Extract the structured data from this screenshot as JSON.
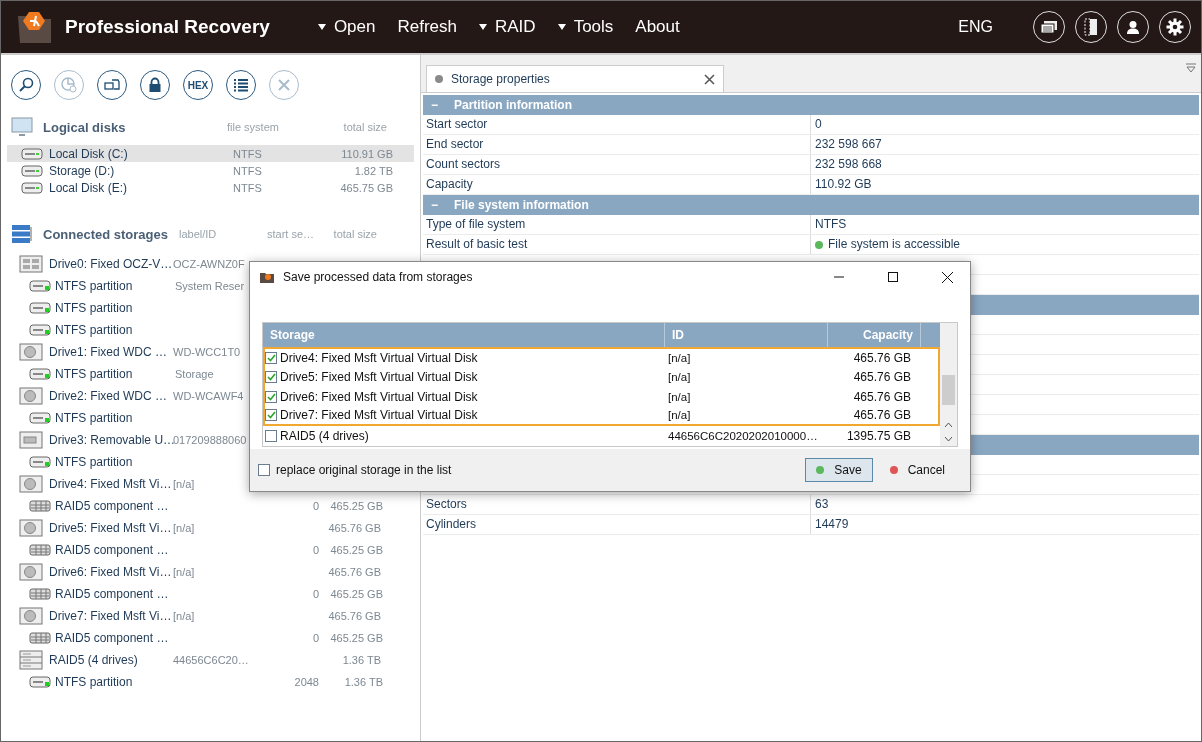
{
  "app": {
    "title": "Professional Recovery",
    "language": "ENG"
  },
  "menu": [
    {
      "label": "Open",
      "dropdown": true
    },
    {
      "label": "Refresh",
      "dropdown": false
    },
    {
      "label": "RAID",
      "dropdown": true
    },
    {
      "label": "Tools",
      "dropdown": true
    },
    {
      "label": "About",
      "dropdown": false
    }
  ],
  "top_icons": [
    {
      "kind": "windows"
    },
    {
      "kind": "panel"
    },
    {
      "kind": "user"
    },
    {
      "kind": "settings"
    }
  ],
  "toolbar": [
    {
      "kind": "search",
      "disabled": false
    },
    {
      "kind": "chart",
      "disabled": true
    },
    {
      "kind": "files",
      "disabled": false
    },
    {
      "kind": "lock",
      "disabled": false
    },
    {
      "kind": "hex",
      "label": "HEX",
      "disabled": false
    },
    {
      "kind": "list",
      "disabled": false
    },
    {
      "kind": "close",
      "disabled": true
    }
  ],
  "logical_disks": {
    "title": "Logical disks",
    "columns": [
      "file system",
      "total size"
    ],
    "items": [
      {
        "name": "Local Disk (C:)",
        "fs": "NTFS",
        "size": "110.91 GB",
        "selected": true
      },
      {
        "name": "Storage (D:)",
        "fs": "NTFS",
        "size": "1.82 TB",
        "selected": false
      },
      {
        "name": "Local Disk (E:)",
        "fs": "NTFS",
        "size": "465.75 GB",
        "selected": false
      }
    ]
  },
  "storages": {
    "title": "Connected storages",
    "columns": [
      "label/ID",
      "start se…",
      "total size"
    ],
    "items": [
      {
        "kind": "ssd",
        "name": "Drive0: Fixed OCZ-V…",
        "label": "OCZ-AWNZ0F",
        "children": [
          {
            "kind": "partition",
            "name": "NTFS partition",
            "label": "System Reser"
          },
          {
            "kind": "partition",
            "name": "NTFS partition"
          },
          {
            "kind": "partition",
            "name": "NTFS partition"
          }
        ]
      },
      {
        "kind": "drive",
        "name": "Drive1: Fixed WDC …",
        "label": "WD-WCC1T0",
        "children": [
          {
            "kind": "partition",
            "name": "NTFS partition",
            "label": "Storage"
          }
        ]
      },
      {
        "kind": "drive",
        "name": "Drive2: Fixed WDC …",
        "label": "WD-WCAWF4",
        "children": [
          {
            "kind": "partition",
            "name": "NTFS partition"
          }
        ]
      },
      {
        "kind": "removable",
        "name": "Drive3: Removable U…",
        "label": "017209888060",
        "children": [
          {
            "kind": "partition",
            "name": "NTFS partition"
          }
        ]
      },
      {
        "kind": "drive",
        "name": "Drive4: Fixed Msft Vi…",
        "label": "[n/a]",
        "children": [
          {
            "kind": "component",
            "name": "RAID5 component …",
            "start": "0",
            "size": "465.25 GB"
          }
        ]
      },
      {
        "kind": "drive",
        "name": "Drive5: Fixed Msft Vi…",
        "label": "[n/a]",
        "size": "465.76 GB",
        "children": [
          {
            "kind": "component",
            "name": "RAID5 component …",
            "start": "0",
            "size": "465.25 GB"
          }
        ]
      },
      {
        "kind": "drive",
        "name": "Drive6: Fixed Msft Vi…",
        "label": "[n/a]",
        "size": "465.76 GB",
        "children": [
          {
            "kind": "component",
            "name": "RAID5 component …",
            "start": "0",
            "size": "465.25 GB"
          }
        ]
      },
      {
        "kind": "drive",
        "name": "Drive7: Fixed Msft Vi…",
        "label": "[n/a]",
        "size": "465.76 GB",
        "children": [
          {
            "kind": "component",
            "name": "RAID5 component …",
            "start": "0",
            "size": "465.25 GB"
          }
        ]
      },
      {
        "kind": "raid",
        "name": "RAID5 (4 drives)",
        "label": "44656C6C20…",
        "size": "1.36 TB",
        "children": [
          {
            "kind": "partition",
            "name": "NTFS partition",
            "start": "2048",
            "size": "1.36 TB"
          }
        ]
      }
    ]
  },
  "properties": {
    "tab": {
      "label": "Storage properties"
    },
    "sections": [
      {
        "toggle": "−",
        "title": "Partition information",
        "rows": [
          [
            "Start sector",
            "0"
          ],
          [
            "End sector",
            "232 598 667"
          ],
          [
            "Count sectors",
            "232 598 668"
          ],
          [
            "Capacity",
            "110.92 GB"
          ]
        ]
      },
      {
        "toggle": "−",
        "title": "File system information",
        "rows": [
          [
            "Type of file system",
            "NTFS"
          ],
          [
            "Result of basic test",
            "File system is accessible"
          ]
        ]
      }
    ],
    "more_rows": [
      [
        "Sectors",
        "63"
      ],
      [
        "Cylinders",
        "14479"
      ]
    ]
  },
  "dialog": {
    "title": "Save processed data from storages",
    "columns": [
      "Storage",
      "ID",
      "Capacity"
    ],
    "rows": [
      {
        "name": "Drive4: Fixed Msft Virtual Virtual Disk",
        "id": "[n/a]",
        "capacity": "465.76 GB",
        "checked": true,
        "selected": true
      },
      {
        "name": "Drive5: Fixed Msft Virtual Virtual Disk",
        "id": "[n/a]",
        "capacity": "465.76 GB",
        "checked": true,
        "selected": true
      },
      {
        "name": "Drive6: Fixed Msft Virtual Virtual Disk",
        "id": "[n/a]",
        "capacity": "465.76 GB",
        "checked": true,
        "selected": true
      },
      {
        "name": "Drive7: Fixed Msft Virtual Virtual Disk",
        "id": "[n/a]",
        "capacity": "465.76 GB",
        "checked": true,
        "selected": true
      },
      {
        "name": "RAID5 (4 drives)",
        "id": "44656C6C2020202010000…",
        "capacity": "1395.75 GB",
        "checked": false,
        "selected": false
      }
    ],
    "replace": {
      "label": "replace original storage in the list",
      "checked": false
    },
    "buttons": [
      {
        "label": "Save",
        "color": "#5cb85c",
        "default": true
      },
      {
        "label": "Cancel",
        "color": "#e05555",
        "default": false
      }
    ]
  }
}
